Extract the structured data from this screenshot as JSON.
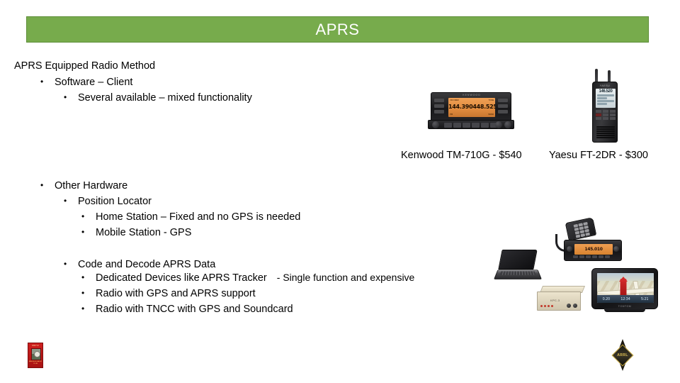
{
  "slide": {
    "title": "APRS",
    "title_bar_color": "#77ab4c",
    "background_color": "#ffffff"
  },
  "content": {
    "heading": "APRS Equipped Radio Method",
    "bullet_glyph": "•",
    "lines": [
      {
        "level": 1,
        "text": "Software – Client"
      },
      {
        "level": 2,
        "text": "Several available – mixed functionality"
      },
      {
        "level": 1,
        "text": "Other Hardware"
      },
      {
        "level": 2,
        "text": "Position Locator"
      },
      {
        "level": 3,
        "text": "Home Station – Fixed and no GPS is needed"
      },
      {
        "level": 3,
        "text": "Mobile Station - GPS"
      },
      {
        "level": 2,
        "text": "Code and Decode APRS Data"
      },
      {
        "level": 3,
        "text": "Dedicated Devices like APRS Tracker",
        "suffix": "- Single function and expensive"
      },
      {
        "level": 3,
        "text": "Radio with GPS and APRS support"
      },
      {
        "level": 3,
        "text": "Radio with TNCC with GPS and Soundcard"
      }
    ]
  },
  "captions": {
    "kenwood": "Kenwood TM-710G - $540",
    "yaesu": "Yaesu FT-2DR - $300"
  },
  "images": {
    "kenwood_radio": {
      "name": "kenwood-tm-710g-mobile-radio",
      "brand": "KENWOOD",
      "display_freq_a": "144.390",
      "display_freq_b": "448.525",
      "display_top_left": "VFO MEM",
      "display_top_right": "TONE",
      "display_bottom_left": "PM",
      "display_bottom_right": "BAND",
      "screen_color": "#e08b3e"
    },
    "yaesu_radio": {
      "name": "yaesu-ft-2dr-handheld-radio",
      "brand": "YAESU",
      "display_freq": "146.520"
    },
    "laptop": {
      "name": "laptop-computer"
    },
    "mobile_radio": {
      "name": "mobile-radio-with-microphone",
      "display_text": "145.010"
    },
    "tnc_box": {
      "name": "tnc-modem-box",
      "label": "KPC-3"
    },
    "gps_navigator": {
      "name": "gps-navigator",
      "brand": "TOMTOM",
      "distance": "0.20",
      "field_2": "12:34",
      "field_3": "5:21"
    },
    "red_badge": {
      "name": "red-club-badge",
      "title": "W6XYZ",
      "caption": "AMATEUR RADIO CLUB"
    },
    "arrl_logo": {
      "name": "arrl-diamond-logo",
      "letters": "ARRL"
    }
  }
}
